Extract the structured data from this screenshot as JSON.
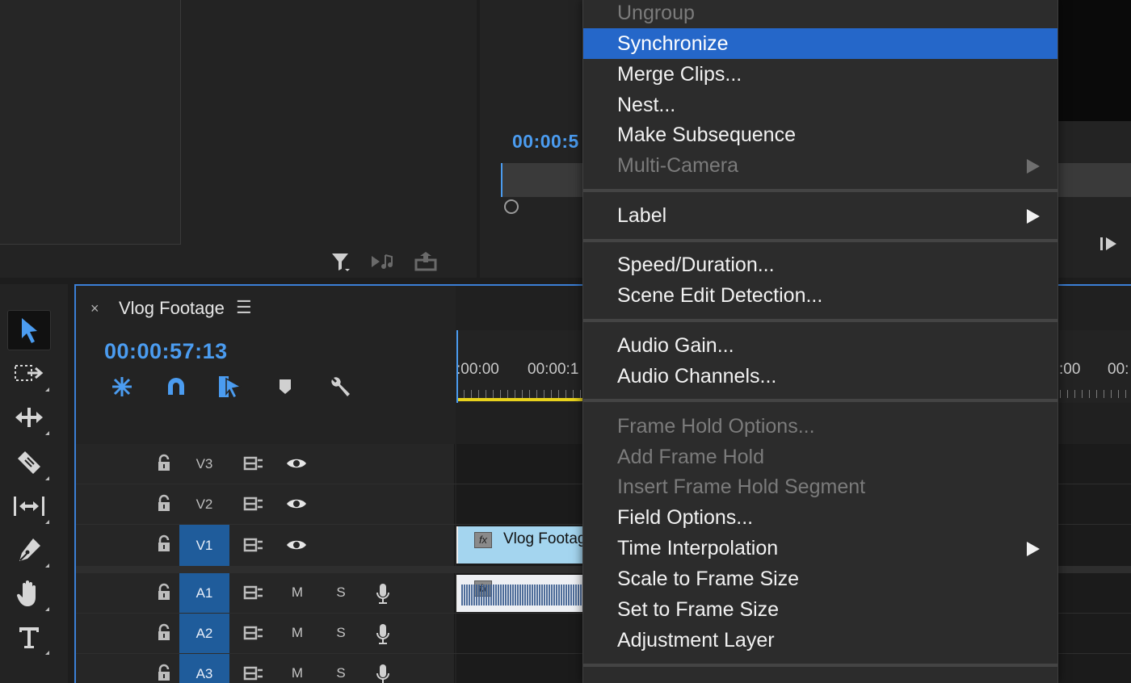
{
  "program_monitor": {
    "timecode": "00:00:5"
  },
  "timeline": {
    "title": "Vlog Footage",
    "close_glyph": "×",
    "menu_glyph": "☰",
    "timecode": "00:00:57:13",
    "ruler_labels": [
      ":00:00",
      "00:00:1",
      ":00",
      "00:"
    ],
    "tracks": {
      "video": [
        "V3",
        "V2",
        "V1"
      ],
      "audio": [
        "A1",
        "A2",
        "A3"
      ],
      "mute_label": "M",
      "solo_label": "S"
    },
    "clip_name": "Vlog Footage",
    "fx_badge": "fx"
  },
  "context_menu": {
    "items": [
      {
        "label": "Ungroup",
        "disabled": true
      },
      {
        "label": "Synchronize",
        "highlighted": true
      },
      {
        "label": "Merge Clips..."
      },
      {
        "label": "Nest..."
      },
      {
        "label": "Make Subsequence"
      },
      {
        "label": "Multi-Camera",
        "disabled": true,
        "submenu": true
      },
      {
        "label": "Label",
        "submenu": true
      },
      {
        "label": "Speed/Duration..."
      },
      {
        "label": "Scene Edit Detection..."
      },
      {
        "label": "Audio Gain..."
      },
      {
        "label": "Audio Channels..."
      },
      {
        "label": "Frame Hold Options...",
        "disabled": true
      },
      {
        "label": "Add Frame Hold",
        "disabled": true
      },
      {
        "label": "Insert Frame Hold Segment",
        "disabled": true
      },
      {
        "label": "Field Options..."
      },
      {
        "label": "Time Interpolation",
        "submenu": true
      },
      {
        "label": "Scale to Frame Size"
      },
      {
        "label": "Set to Frame Size"
      },
      {
        "label": "Adjustment Layer"
      }
    ]
  },
  "colors": {
    "accent": "#4b9cf0",
    "menu_highlight": "#2567c9",
    "track_target": "#1f5c9b",
    "video_clip": "#a4d5ef",
    "work_area": "#e8d21d"
  },
  "icons": {
    "source_controls": [
      "filter-icon",
      "insert-icon",
      "export-icon"
    ],
    "tools": [
      "selection-tool-icon",
      "track-select-tool-icon",
      "ripple-edit-tool-icon",
      "razor-tool-icon",
      "slip-tool-icon",
      "pen-tool-icon",
      "hand-tool-icon",
      "type-tool-icon"
    ],
    "timeline_controls": [
      "snap-nest-icon",
      "snap-magnet-icon",
      "linked-selection-icon",
      "add-marker-icon",
      "timeline-settings-wrench-icon"
    ]
  }
}
